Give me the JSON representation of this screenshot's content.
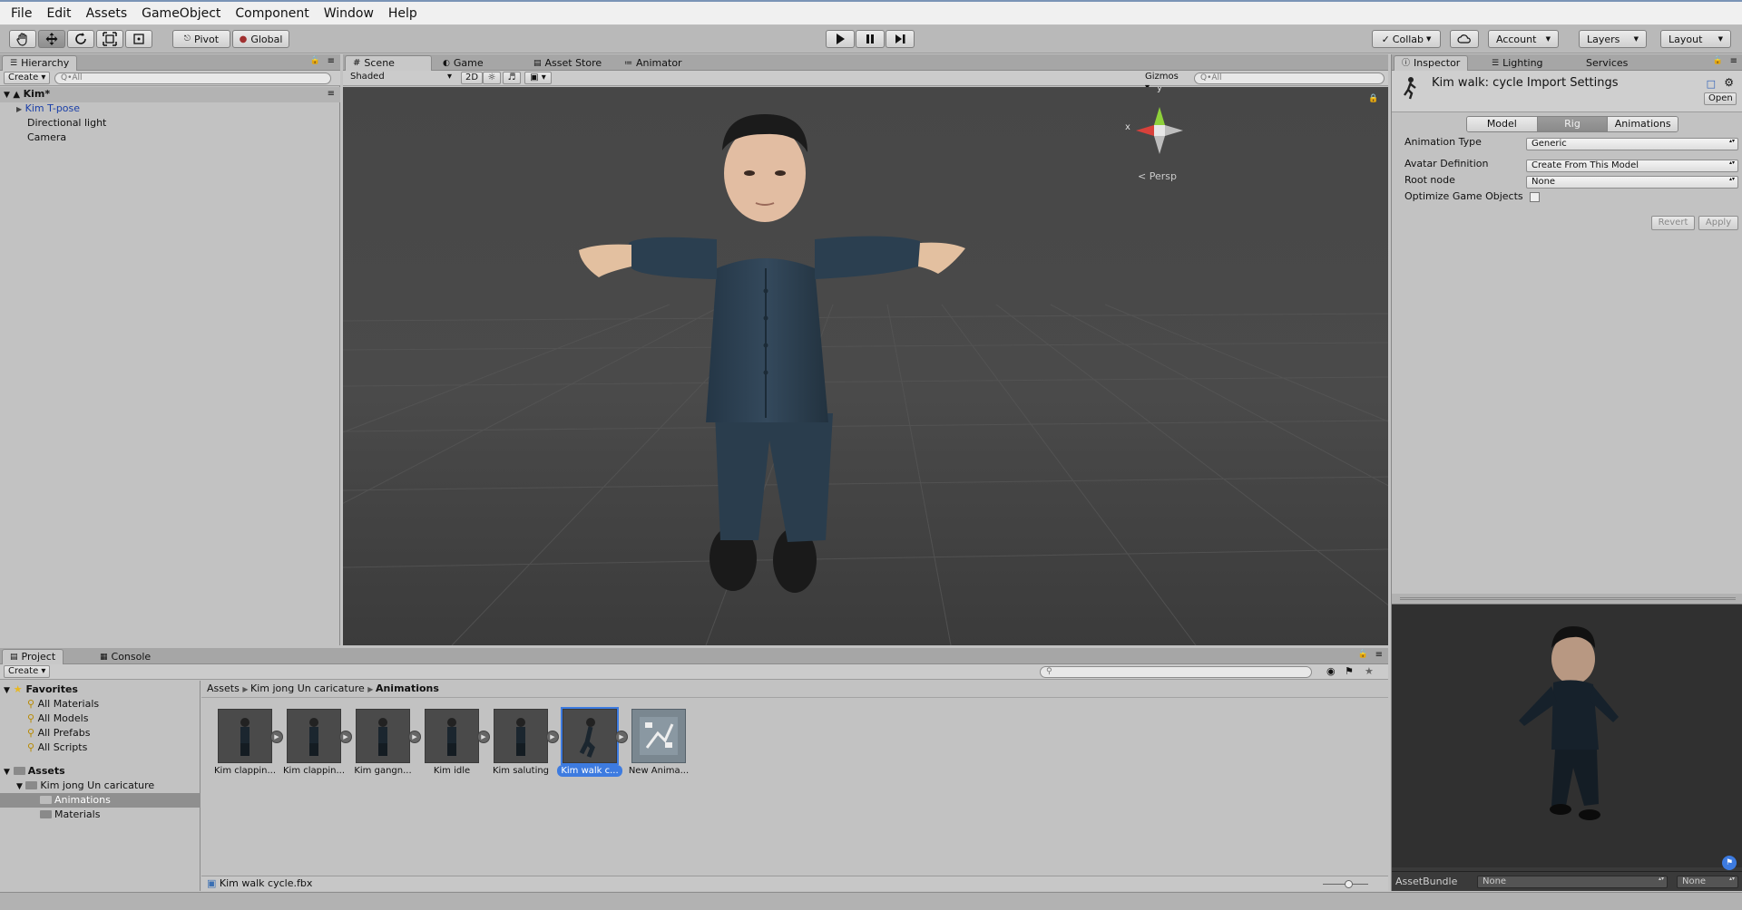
{
  "menu": [
    "File",
    "Edit",
    "Assets",
    "GameObject",
    "Component",
    "Window",
    "Help"
  ],
  "toolbar": {
    "pivot": "Pivot",
    "global": "Global",
    "collab": "Collab",
    "account": "Account",
    "layers": "Layers",
    "layout": "Layout"
  },
  "hierarchy": {
    "tab": "Hierarchy",
    "create": "Create",
    "search_placeholder": "Q•All",
    "scene": "Kim*",
    "items": [
      "Kim T-pose",
      "Directional light",
      "Camera"
    ]
  },
  "scene_view": {
    "tabs": [
      "Scene",
      "Game",
      "Asset Store",
      "Animator"
    ],
    "shading": "Shaded",
    "mode_2d": "2D",
    "gizmos": "Gizmos",
    "search_placeholder": "Q•All",
    "gizmo_axis_y": "y",
    "gizmo_axis_x": "x",
    "projection": "Persp"
  },
  "inspector": {
    "tabs": [
      "Inspector",
      "Lighting",
      "Services"
    ],
    "title": "Kim walk: cycle Import Settings",
    "open": "Open",
    "subtabs": [
      "Model",
      "Rig",
      "Animations"
    ],
    "active_subtab": "Rig",
    "fields": [
      {
        "label": "Animation Type",
        "value": "Generic"
      },
      {
        "label": "Avatar Definition",
        "value": "Create From This Model"
      },
      {
        "label": "Root node",
        "value": "None"
      }
    ],
    "optimize_label": "Optimize Game Objects",
    "revert": "Revert",
    "apply": "Apply",
    "assetbundle_label": "AssetBundle",
    "assetbundle_value": "None",
    "assetbundle_variant": "None"
  },
  "project": {
    "tabs": [
      "Project",
      "Console"
    ],
    "create": "Create",
    "favorites_label": "Favorites",
    "favorites": [
      "All Materials",
      "All Models",
      "All Prefabs",
      "All Scripts"
    ],
    "assets_label": "Assets",
    "tree": [
      "Kim jong Un caricature",
      "Animations",
      "Materials"
    ],
    "breadcrumb": [
      "Assets",
      "Kim jong Un caricature",
      "Animations"
    ],
    "assets": [
      "Kim clappin...",
      "Kim clappin...",
      "Kim gangn...",
      "Kim idle",
      "Kim saluting",
      "Kim walk c...",
      "New Anima..."
    ],
    "selected_file": "Kim walk cycle.fbx"
  },
  "colors": {
    "selection": "#3d7be0",
    "viewport_bg": "#484848"
  }
}
